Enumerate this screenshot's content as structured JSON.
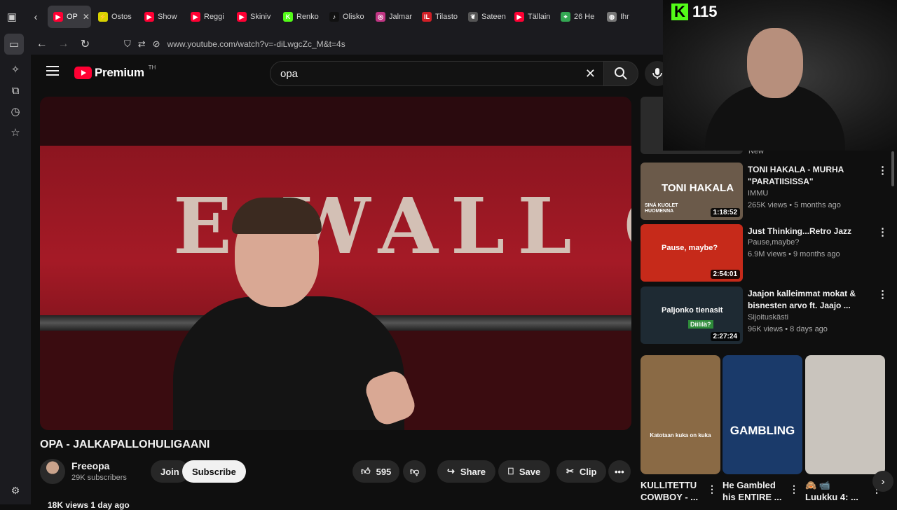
{
  "browser": {
    "tabs": [
      {
        "label": "OP",
        "active": true,
        "fav": "yt",
        "color": "#ff0033"
      },
      {
        "label": "Ostos",
        "fav": "bolt",
        "color": "#d8d200"
      },
      {
        "label": "Show",
        "fav": "yt",
        "color": "#ff0033"
      },
      {
        "label": "Reggi",
        "fav": "yt",
        "color": "#ff0033"
      },
      {
        "label": "Skiniv",
        "fav": "yt",
        "color": "#ff0033"
      },
      {
        "label": "Renko",
        "fav": "k",
        "color": "#53fc18"
      },
      {
        "label": "Olisko",
        "fav": "tt",
        "color": "#111111"
      },
      {
        "label": "Jalmar",
        "fav": "ig",
        "color": "#c13584"
      },
      {
        "label": "Tilasto",
        "fav": "il",
        "color": "#d11f26"
      },
      {
        "label": "Sateen",
        "fav": "leaf",
        "color": "#555555"
      },
      {
        "label": "Tällain",
        "fav": "yt",
        "color": "#ff0033"
      },
      {
        "label": "26 He",
        "fav": "map",
        "color": "#34a853"
      },
      {
        "label": "Ihmis",
        "fav": "globe",
        "color": "#777777"
      }
    ],
    "url": "www.youtube.com/watch?v=-diLwgcZc_M&t=4s"
  },
  "youtube": {
    "logo_text": "Premium",
    "logo_sup": "TH",
    "search_query": "opa"
  },
  "video": {
    "title": "OPA - JALKAPALLOHULIGAANI",
    "player_sign": "E WALL OF",
    "channel": "Freeopa",
    "subscribers": "29K subscribers",
    "join_label": "Join",
    "subscribe_label": "Subscribe",
    "likes": "595",
    "share_label": "Share",
    "save_label": "Save",
    "clip_label": "Clip",
    "views_line": "18K views  1 day ago"
  },
  "stream": {
    "platform_icon": "kick-logo",
    "viewer_count": "115"
  },
  "related": [
    {
      "title": "",
      "channel": "",
      "meta": "New",
      "duration": "",
      "color": "#2b2b2b"
    },
    {
      "title": "TONI HAKALA -  MURHA \"PARATIISISSA\"",
      "channel": "IMMU",
      "meta": "265K views • 5 months ago",
      "duration": "1:18:52",
      "thumb_text": "TONI HAKALA",
      "thumb_sub": "SINÄ KUOLET HUOMENNA",
      "color": "#6b5a4a"
    },
    {
      "title": "Just Thinking...Retro Jazz",
      "channel": "Pause,maybe?",
      "meta": "6.9M views • 9 months ago",
      "duration": "2:54:01",
      "thumb_text": "Pause, maybe?",
      "color": "#c62a1a"
    },
    {
      "title": "Jaajon kalleimmat mokat & bisnesten arvo ft. Jaajo ...",
      "channel": "Sijoituskästi",
      "meta": "96K views • 8 days ago",
      "duration": "2:27:24",
      "thumb_text": "Paljonko tienasit",
      "thumb_badge": "Diililä?",
      "color": "#1e2a33"
    }
  ],
  "shorts": [
    {
      "title_line1": "KULLITETTU",
      "title_line2": "COWBOY - ...",
      "thumb_text": "Katotaan kuka on kuka",
      "color": "#8a6a45"
    },
    {
      "title_line1": "He Gambled",
      "title_line2": "his ENTIRE ...",
      "thumb_text": "GAMBLING",
      "color": "#1a3a6a"
    },
    {
      "title_line1": "🙈 📹",
      "title_line2": "Luukku 4: ...",
      "thumb_text": "",
      "color": "#c9c4bd"
    }
  ]
}
